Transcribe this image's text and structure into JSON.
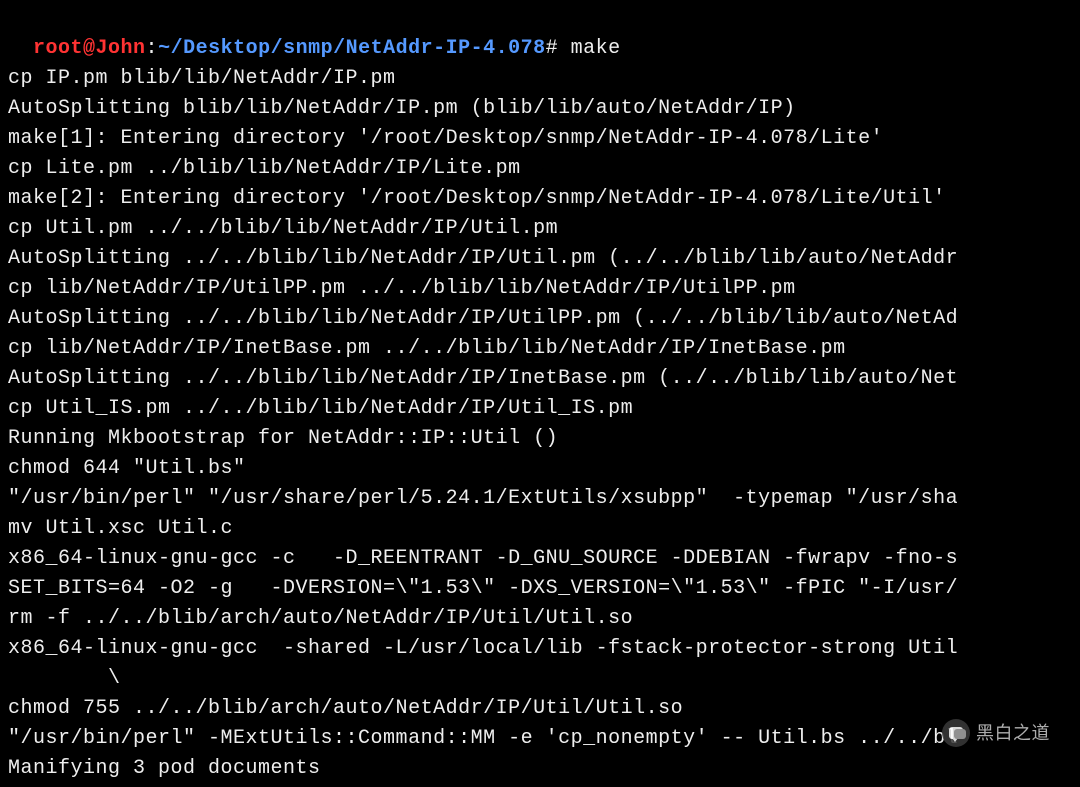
{
  "prompt": {
    "user": "root@John",
    "sep1": ":",
    "path": "~/Desktop/snmp/NetAddr-IP-4.078",
    "sep2": "#",
    "command": " make"
  },
  "lines": [
    "cp IP.pm blib/lib/NetAddr/IP.pm",
    "AutoSplitting blib/lib/NetAddr/IP.pm (blib/lib/auto/NetAddr/IP)",
    "make[1]: Entering directory '/root/Desktop/snmp/NetAddr-IP-4.078/Lite'",
    "cp Lite.pm ../blib/lib/NetAddr/IP/Lite.pm",
    "make[2]: Entering directory '/root/Desktop/snmp/NetAddr-IP-4.078/Lite/Util'",
    "cp Util.pm ../../blib/lib/NetAddr/IP/Util.pm",
    "AutoSplitting ../../blib/lib/NetAddr/IP/Util.pm (../../blib/lib/auto/NetAddr",
    "cp lib/NetAddr/IP/UtilPP.pm ../../blib/lib/NetAddr/IP/UtilPP.pm",
    "AutoSplitting ../../blib/lib/NetAddr/IP/UtilPP.pm (../../blib/lib/auto/NetAd",
    "cp lib/NetAddr/IP/InetBase.pm ../../blib/lib/NetAddr/IP/InetBase.pm",
    "AutoSplitting ../../blib/lib/NetAddr/IP/InetBase.pm (../../blib/lib/auto/Net",
    "cp Util_IS.pm ../../blib/lib/NetAddr/IP/Util_IS.pm",
    "Running Mkbootstrap for NetAddr::IP::Util ()",
    "chmod 644 \"Util.bs\"",
    "\"/usr/bin/perl\" \"/usr/share/perl/5.24.1/ExtUtils/xsubpp\"  -typemap \"/usr/sha",
    "mv Util.xsc Util.c",
    "x86_64-linux-gnu-gcc -c   -D_REENTRANT -D_GNU_SOURCE -DDEBIAN -fwrapv -fno-s",
    "SET_BITS=64 -O2 -g   -DVERSION=\\\"1.53\\\" -DXS_VERSION=\\\"1.53\\\" -fPIC \"-I/usr/",
    "rm -f ../../blib/arch/auto/NetAddr/IP/Util/Util.so",
    "x86_64-linux-gnu-gcc  -shared -L/usr/local/lib -fstack-protector-strong Util",
    "        \\",
    "",
    "chmod 755 ../../blib/arch/auto/NetAddr/IP/Util/Util.so",
    "\"/usr/bin/perl\" -MExtUtils::Command::MM -e 'cp_nonempty' -- Util.bs ../../bl",
    "Manifying 3 pod documents"
  ],
  "watermark": {
    "text": "黑白之道"
  }
}
